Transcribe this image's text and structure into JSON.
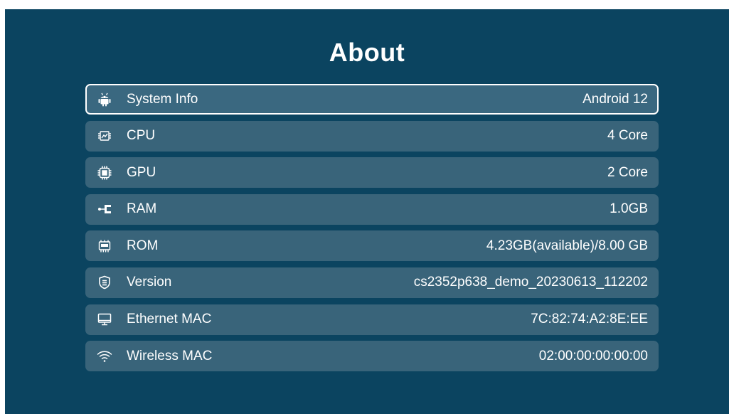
{
  "page": {
    "title": "About"
  },
  "colors": {
    "background": "#0b4460",
    "row": "#39647a",
    "text": "#ffffff"
  },
  "items": [
    {
      "label": "System Info",
      "value": "Android 12",
      "icon": "android-icon",
      "selected": true
    },
    {
      "label": "CPU",
      "value": "4 Core",
      "icon": "cpu-icon",
      "selected": false
    },
    {
      "label": "GPU",
      "value": "2 Core",
      "icon": "gpu-chip-icon",
      "selected": false
    },
    {
      "label": "RAM",
      "value": "1.0GB",
      "icon": "ram-icon",
      "selected": false
    },
    {
      "label": "ROM",
      "value": "4.23GB(available)/8.00 GB",
      "icon": "rom-icon",
      "selected": false
    },
    {
      "label": "Version",
      "value": "cs2352p638_demo_20230613_112202",
      "icon": "shield-icon",
      "selected": false
    },
    {
      "label": "Ethernet MAC",
      "value": "7C:82:74:A2:8E:EE",
      "icon": "monitor-icon",
      "selected": false
    },
    {
      "label": "Wireless MAC",
      "value": "02:00:00:00:00:00",
      "icon": "wifi-icon",
      "selected": false
    }
  ]
}
